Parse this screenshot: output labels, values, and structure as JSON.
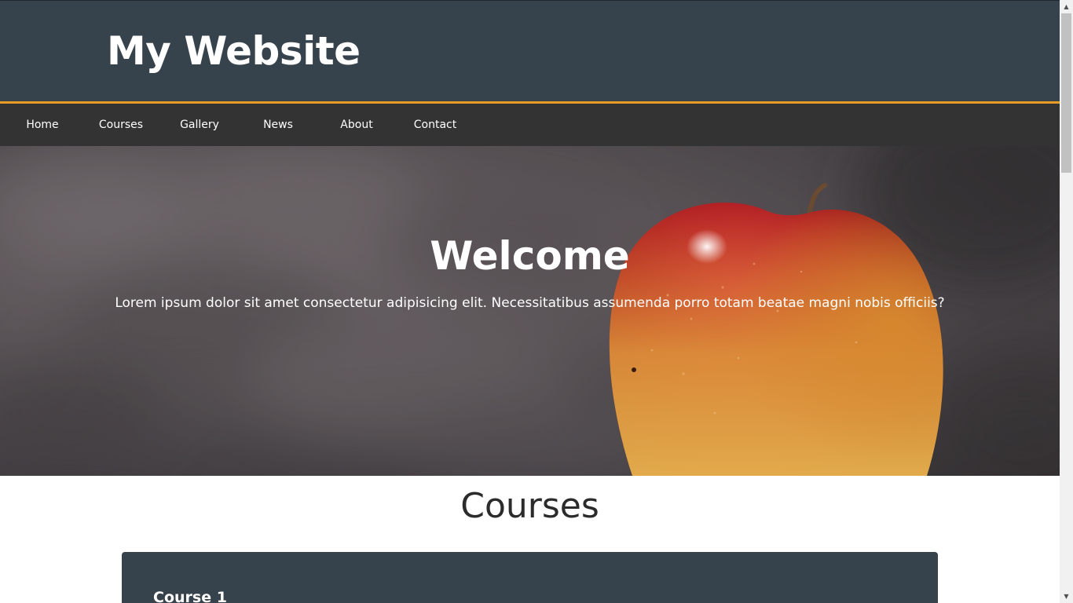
{
  "header": {
    "site_title": "My Website"
  },
  "nav": {
    "items": [
      {
        "label": "Home"
      },
      {
        "label": "Courses"
      },
      {
        "label": "Gallery"
      },
      {
        "label": "News"
      },
      {
        "label": "About"
      },
      {
        "label": "Contact"
      }
    ]
  },
  "hero": {
    "heading": "Welcome",
    "text": "Lorem ipsum dolor sit amet consectetur adipisicing elit. Necessitatibus assumenda porro totam beatae magni nobis officiis?",
    "image": "apple-photo"
  },
  "courses": {
    "heading": "Courses",
    "items": [
      {
        "title": "Course 1"
      }
    ]
  },
  "colors": {
    "header_bg": "#37434c",
    "accent": "#e89b25",
    "nav_bg": "#333333",
    "card_bg": "#37434c"
  },
  "scrollbar": {
    "up_icon": "arrow-up-icon",
    "down_icon": "arrow-down-icon"
  }
}
